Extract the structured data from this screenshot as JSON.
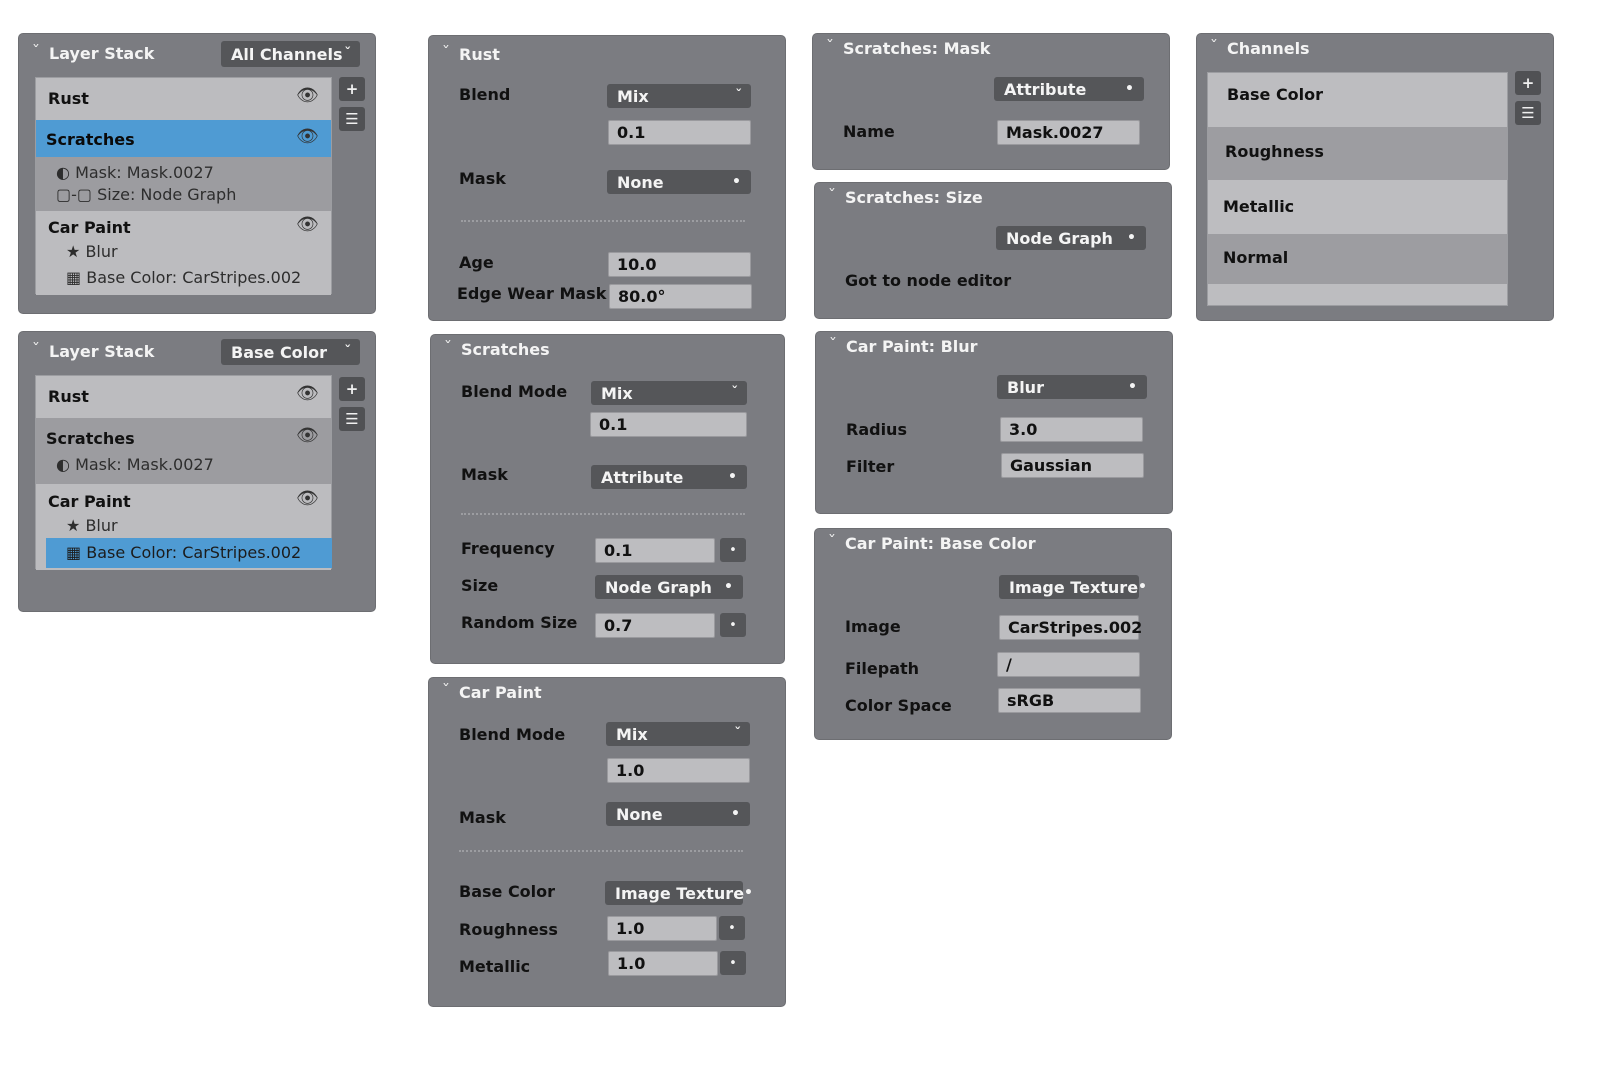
{
  "layer_stack_1": {
    "title": "Layer Stack",
    "channel": "All Channels",
    "layers": [
      {
        "name": "Rust",
        "subs": []
      },
      {
        "name": "Scratches",
        "subs": [
          "Mask: Mask.0027",
          "Size: Node Graph"
        ]
      },
      {
        "name": "Car Paint",
        "subs": [
          "Blur",
          "Base Color: CarStripes.002"
        ]
      }
    ],
    "sub_icons": {
      "mask": "◐",
      "size": "▢-▢",
      "blur": "★",
      "texture": "▦"
    },
    "eye_icon": "👁",
    "add_label": "+",
    "menu_label": "☰",
    "selected_color": "#4f9bd3"
  },
  "layer_stack_2": {
    "title": "Layer Stack",
    "channel": "Base Color",
    "layers": [
      {
        "name": "Rust",
        "subs": []
      },
      {
        "name": "Scratches",
        "subs": [
          "Mask: Mask.0027"
        ]
      },
      {
        "name": "Car Paint",
        "subs": [
          "Blur",
          "Base Color: CarStripes.002"
        ]
      }
    ]
  },
  "rust": {
    "title": "Rust",
    "blend_label": "Blend",
    "blend_mode": "Mix",
    "blend_value": "0.1",
    "mask_label": "Mask",
    "mask_value": "None",
    "age_label": "Age",
    "age_value": "10.0",
    "edge_label": "Edge Wear Mask",
    "edge_value": "80.0°"
  },
  "scratches": {
    "title": "Scratches",
    "blend_label": "Blend Mode",
    "blend_mode": "Mix",
    "blend_value": "0.1",
    "mask_label": "Mask",
    "mask_value": "Attribute",
    "freq_label": "Frequency",
    "freq_value": "0.1",
    "size_label": "Size",
    "size_value": "Node Graph",
    "rand_label": "Random Size",
    "rand_value": "0.7"
  },
  "car_paint": {
    "title": "Car Paint",
    "blend_label": "Blend Mode",
    "blend_mode": "Mix",
    "blend_value": "1.0",
    "mask_label": "Mask",
    "mask_value": "None",
    "base_label": "Base Color",
    "base_value": "Image Texture",
    "rough_label": "Roughness",
    "rough_value": "1.0",
    "metal_label": "Metallic",
    "metal_value": "1.0"
  },
  "scratches_mask": {
    "title": "Scratches: Mask",
    "type_value": "Attribute",
    "name_label": "Name",
    "name_value": "Mask.0027"
  },
  "scratches_size": {
    "title": "Scratches: Size",
    "type_value": "Node Graph",
    "link_label": "Got to node editor"
  },
  "car_paint_blur": {
    "title": "Car Paint: Blur",
    "type_value": "Blur",
    "radius_label": "Radius",
    "radius_value": "3.0",
    "filter_label": "Filter",
    "filter_value": "Gaussian"
  },
  "car_paint_base": {
    "title": "Car Paint: Base Color",
    "type_value": "Image Texture",
    "image_label": "Image",
    "image_value": "CarStripes.002",
    "path_label": "Filepath",
    "path_value": "/",
    "cs_label": "Color Space",
    "cs_value": "sRGB"
  },
  "channels": {
    "title": "Channels",
    "items": [
      "Base Color",
      "Roughness",
      "Metallic",
      "Normal"
    ]
  },
  "glyphs": {
    "chevron": "˅",
    "dot": "•"
  }
}
